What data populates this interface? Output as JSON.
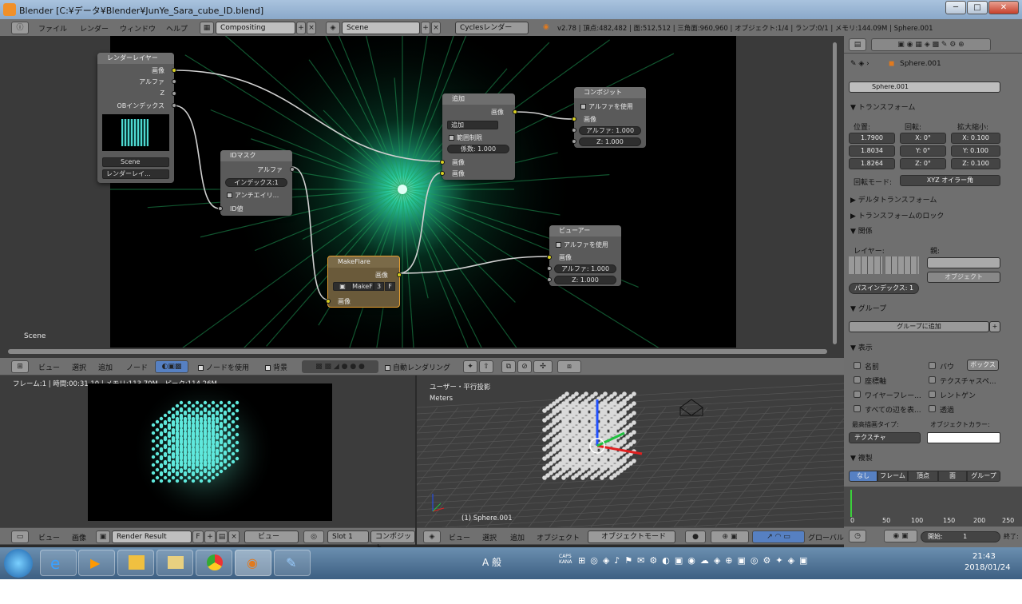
{
  "window": {
    "title": "Blender  [C:¥データ¥Blender¥JunYe_Sara_cube_ID.blend]",
    "minimize": "─",
    "maximize": "□",
    "close": "✕"
  },
  "header": {
    "menus": [
      "ファイル",
      "レンダー",
      "ウィンドウ",
      "ヘルプ"
    ],
    "layout": "Compositing",
    "scene": "Scene",
    "engine": "Cyclesレンダー",
    "stats": "v2.78 | 頂点:482,482 | 面:512,512 | 三角面:960,960 | オブジェクト:1/4 | ランプ:0/1 | メモリ:144.09M | Sphere.001"
  },
  "nodes": {
    "render_layers": {
      "title": "レンダーレイヤー",
      "outputs": [
        "画像",
        "アルファ",
        "Z",
        "OBインデックス"
      ],
      "scene": "Scene",
      "layer": "レンダーレイ..."
    },
    "id_mask": {
      "title": "IDマスク",
      "output": "アルファ",
      "index": "インデックス:1",
      "antialias": "アンチエイリ...",
      "input": "ID値"
    },
    "add": {
      "title": "追加",
      "output": "画像",
      "mode": "追加",
      "clamp": "範囲制限",
      "factor_label": "係数:",
      "factor": "1.000",
      "in1": "画像",
      "in2": "画像"
    },
    "composite": {
      "title": "コンポジット",
      "use_alpha": "アルファを使用",
      "in_image": "画像",
      "alpha": "アルファ: 1.000",
      "z_label": "Z:",
      "z": "1.000"
    },
    "viewer": {
      "title": "ビューアー",
      "use_alpha": "アルファを使用",
      "in_image": "画像",
      "alpha": "アルファ: 1.000",
      "z_label": "Z:",
      "z": "1.000"
    },
    "makeflare": {
      "title": "MakeFlare",
      "output": "画像",
      "group": "MakeF",
      "users": "3",
      "fake": "F",
      "input": "画像"
    },
    "scene_label": "Scene"
  },
  "node_header": {
    "items": [
      "ビュー",
      "選択",
      "追加",
      "ノード"
    ],
    "use_nodes": "ノードを使用",
    "backdrop": "背景",
    "auto_render": "自動レンダリング"
  },
  "image_editor": {
    "info": "フレーム:1 | 時間:00:31.10 | メモリ:113.70M、ピーク:114.26M",
    "menus": [
      "ビュー",
      "画像"
    ],
    "image": "Render Result",
    "fake": "F",
    "view": "ビュー",
    "slot": "Slot 1",
    "pass": "コンポジット"
  },
  "viewport": {
    "mode_label": "ユーザー・平行投影",
    "units": "Meters",
    "object": "(1) Sphere.001",
    "menus": [
      "ビュー",
      "選択",
      "追加",
      "オブジェクト"
    ],
    "obj_mode": "オブジェクトモード",
    "orient": "グローバル"
  },
  "properties": {
    "breadcrumb": "Sphere.001",
    "name": "Sphere.001",
    "transform": "トランスフォーム",
    "loc_label": "位置:",
    "rot_label": "回転:",
    "scale_label": "拡大縮小:",
    "loc": [
      "1.7900",
      "1.8034",
      "1.8264"
    ],
    "rot": [
      "X:",
      "0°",
      "Y:",
      "0°",
      "Z:",
      "0°"
    ],
    "scale": [
      "X: 0.100",
      "Y: 0.100",
      "Z: 0.100"
    ],
    "rot_mode_label": "回転モード:",
    "rot_mode": "XYZ オイラー角",
    "delta": "デルタトランスフォーム",
    "lock": "トランスフォームのロック",
    "relations": "関係",
    "layers_label": "レイヤー:",
    "parent_label": "親:",
    "parent_type": "オブジェクト",
    "pass_index": "パスインデックス: 1",
    "groups": "グループ",
    "add_group": "グループに追加",
    "display": "表示",
    "opts": [
      "名前",
      "バウ",
      "座標軸",
      "テクスチャスペ...",
      "ワイヤーフレー...",
      "レントゲン",
      "すべての辺を表...",
      "透過"
    ],
    "bounds": "ボックス",
    "max_draw_label": "最高描画タイプ:",
    "obj_color_label": "オブジェクトカラー:",
    "max_draw": "テクスチャ",
    "dupli": "複製",
    "dupli_tabs": [
      "なし",
      "フレーム",
      "頂点",
      "面",
      "グループ"
    ],
    "timeline": [
      "0",
      "50",
      "100",
      "150",
      "200",
      "250"
    ],
    "start": "開始:",
    "start_val": "1",
    "end": "終了:"
  },
  "taskbar": {
    "time": "21:43",
    "date": "2018/01/24",
    "ime": "A 般",
    "caps": "CAPS KANA"
  },
  "colors": {
    "accent": "#5680c2",
    "node_yellow": "#d8d021",
    "flare": "#2fffd0"
  }
}
